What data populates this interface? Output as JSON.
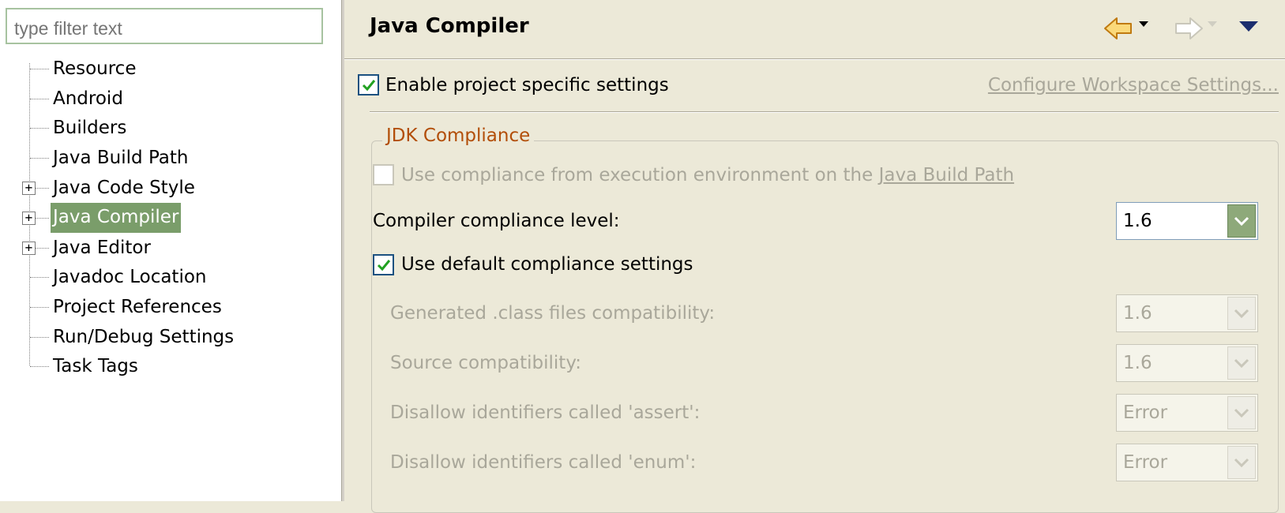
{
  "filter": {
    "placeholder": "type filter text"
  },
  "tree": {
    "items": [
      {
        "label": "Resource",
        "expandable": false,
        "selected": false
      },
      {
        "label": "Android",
        "expandable": false,
        "selected": false
      },
      {
        "label": "Builders",
        "expandable": false,
        "selected": false
      },
      {
        "label": "Java Build Path",
        "expandable": false,
        "selected": false
      },
      {
        "label": "Java Code Style",
        "expandable": true,
        "selected": false
      },
      {
        "label": "Java Compiler",
        "expandable": true,
        "selected": true
      },
      {
        "label": "Java Editor",
        "expandable": true,
        "selected": false
      },
      {
        "label": "Javadoc Location",
        "expandable": false,
        "selected": false
      },
      {
        "label": "Project References",
        "expandable": false,
        "selected": false
      },
      {
        "label": "Run/Debug Settings",
        "expandable": false,
        "selected": false
      },
      {
        "label": "Task Tags",
        "expandable": false,
        "selected": false
      }
    ]
  },
  "header": {
    "title": "Java Compiler",
    "icons": [
      "back-arrow-icon",
      "forward-arrow-icon",
      "view-menu-icon"
    ]
  },
  "project_settings": {
    "enable_label": "Enable project specific settings",
    "enable_checked": true,
    "configure_link": "Configure Workspace Settings..."
  },
  "jdk": {
    "group_title": "JDK Compliance",
    "use_env_prefix": "Use compliance from execution environment on the ",
    "use_env_link": "Java Build Path",
    "use_env_checked": false,
    "compliance_label": "Compiler compliance level:",
    "compliance_value": "1.6",
    "use_default_label": "Use default compliance settings",
    "use_default_checked": true,
    "rows": [
      {
        "label": "Generated .class files compatibility:",
        "value": "1.6"
      },
      {
        "label": "Source compatibility:",
        "value": "1.6"
      },
      {
        "label": "Disallow identifiers called 'assert':",
        "value": "Error"
      },
      {
        "label": "Disallow identifiers called 'enum':",
        "value": "Error"
      }
    ]
  },
  "colors": {
    "selection": "#7a9d6a",
    "group_title": "#b24e08",
    "disabled_text": "#a9a79a",
    "background": "#ece9d8"
  }
}
